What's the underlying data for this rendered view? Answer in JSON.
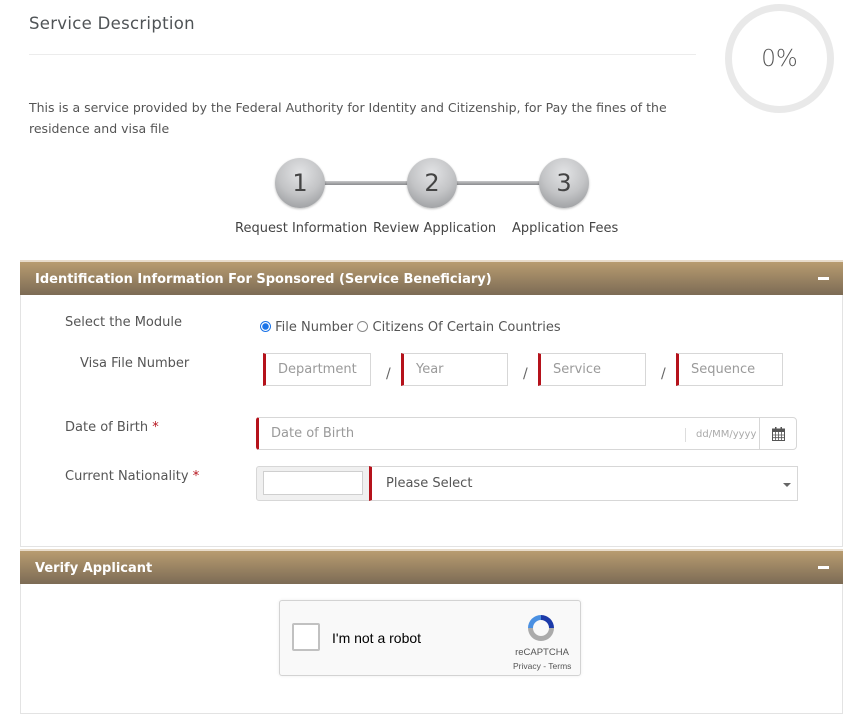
{
  "header": {
    "title": "Service Description",
    "description": "This is a service provided by the Federal Authority for Identity and Citizenship, for Pay the fines of the residence and visa file",
    "progress_percent": 0,
    "progress_label": "0%"
  },
  "steps": [
    {
      "number": "1",
      "label": "Request Information"
    },
    {
      "number": "2",
      "label": "Review Application"
    },
    {
      "number": "3",
      "label": "Application Fees"
    }
  ],
  "identification_panel": {
    "title": "Identification Information For Sponsored (Service Beneficiary)",
    "collapse_icon": "minus-icon",
    "module": {
      "label": "Select the Module",
      "options": [
        {
          "label": "File Number",
          "selected": true
        },
        {
          "label": "Citizens Of Certain Countries",
          "selected": false
        }
      ]
    },
    "visa_file_number": {
      "label": "Visa File Number",
      "separator": "/",
      "fields": [
        {
          "placeholder": "Department",
          "value": ""
        },
        {
          "placeholder": "Year",
          "value": ""
        },
        {
          "placeholder": "Service",
          "value": ""
        },
        {
          "placeholder": "Sequence",
          "value": ""
        }
      ]
    },
    "date_of_birth": {
      "label": "Date of Birth",
      "required_mark": "*",
      "placeholder": "Date of Birth",
      "value": "",
      "format_hint": "dd/MM/yyyy",
      "button_icon": "calendar-icon"
    },
    "nationality": {
      "label": "Current Nationality",
      "required_mark": "*",
      "code_value": "",
      "selected": "Please Select"
    }
  },
  "verify_panel": {
    "title": "Verify Applicant",
    "collapse_icon": "minus-icon",
    "captcha": {
      "checkbox_label": "I'm not a robot",
      "brand": "reCAPTCHA",
      "privacy": "Privacy",
      "separator": " - ",
      "terms": "Terms",
      "checked": false
    }
  }
}
